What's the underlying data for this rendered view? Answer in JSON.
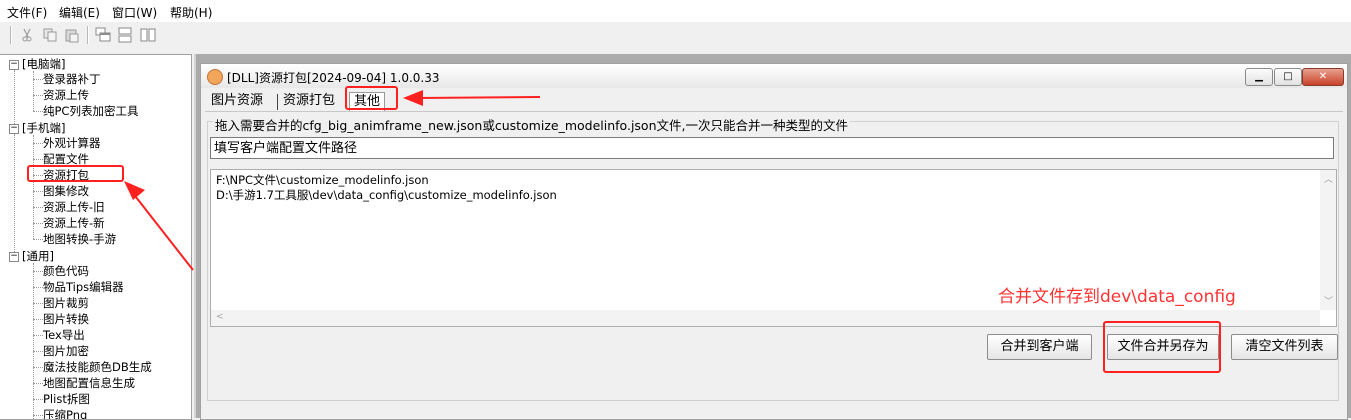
{
  "menu": [
    "文件(F)",
    "编辑(E)",
    "窗口(W)",
    "帮助(H)"
  ],
  "toolbar": {
    "icons": [
      "cut-icon",
      "copy-icon",
      "paste-icon",
      "cascade-icon",
      "tile-horizontal-icon",
      "tile-vertical-icon"
    ]
  },
  "tree": {
    "groups": [
      {
        "label": "[电脑端]",
        "items": [
          "登录器补丁",
          "资源上传",
          "纯PC列表加密工具"
        ]
      },
      {
        "label": "[手机端]",
        "items": [
          "外观计算器",
          "配置文件",
          "资源打包",
          "图集修改",
          "资源上传-旧",
          "资源上传-新",
          "地图转换-手游"
        ]
      },
      {
        "label": "[通用]",
        "items": [
          "颜色代码",
          "物品Tips编辑器",
          "图片裁剪",
          "图片转换",
          "Tex导出",
          "图片加密",
          "魔法技能颜色DB生成",
          "地图配置信息生成",
          "Plist拆图",
          "压缩Png"
        ]
      }
    ]
  },
  "window": {
    "title": "[DLL]资源打包[2024-09-04] 1.0.0.33",
    "tabs": [
      "图片资源",
      "资源打包",
      "其他"
    ],
    "active_tab": "其他",
    "group_label": "拖入需要合并的cfg_big_animframe_new.json或customize_modelinfo.json文件,一次只能合并一种类型的文件",
    "path_input_value": "填写客户端配置文件路径",
    "files": [
      "F:\\NPC文件\\customize_modelinfo.json",
      "D:\\手游1.7工具服\\dev\\data_config\\customize_modelinfo.json"
    ],
    "buttons": {
      "merge_client": "合并到客户端",
      "merge_save_as": "文件合并另存为",
      "clear_list": "清空文件列表"
    }
  },
  "annotation": {
    "text": "合并文件存到dev\\data_config",
    "color": "#ff2020"
  }
}
